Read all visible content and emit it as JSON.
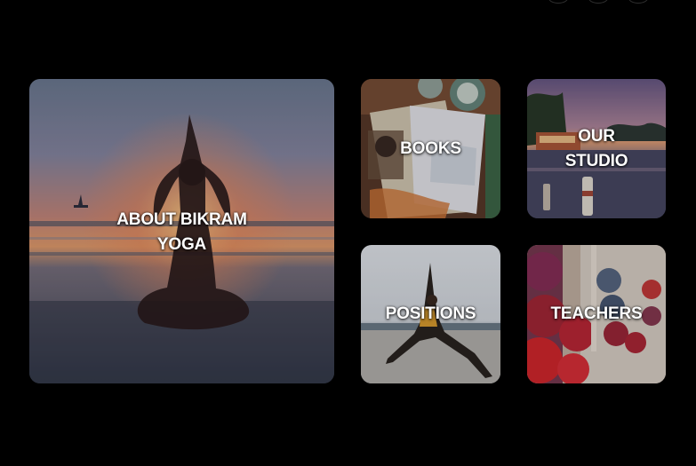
{
  "tiles": {
    "about": "ABOUT BIKRAM YOGA",
    "books": "BOOKS",
    "studio": "OUR STUDIO",
    "positions": "POSITIONS",
    "teachers": "TEACHERS"
  },
  "icons": [
    "carousel-dot-icon",
    "carousel-dot-icon",
    "carousel-dot-icon"
  ]
}
